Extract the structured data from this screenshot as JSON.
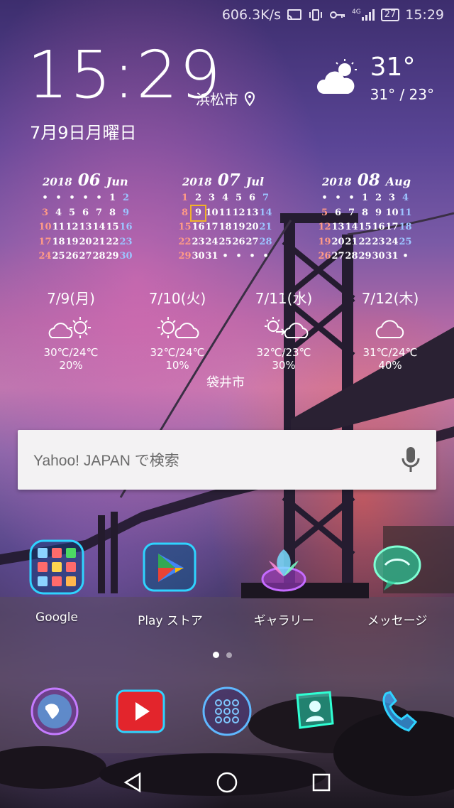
{
  "status_bar": {
    "speed": "606.3K/s",
    "network": "4G",
    "battery": "27",
    "time": "15:29"
  },
  "clock_widget": {
    "time": "15:29",
    "city": "浜松市",
    "date": "7月9日月曜日",
    "temp_now": "31°",
    "temp_range": "31° / 23°"
  },
  "calendars": [
    {
      "year": "2018",
      "month_num": "06",
      "month_name": "Jun",
      "cells": [
        "•",
        "•",
        "•",
        "•",
        "•",
        "1",
        "2",
        "3",
        "4",
        "5",
        "6",
        "7",
        "8",
        "9",
        "10",
        "11",
        "12",
        "13",
        "14",
        "15",
        "16",
        "17",
        "18",
        "19",
        "20",
        "21",
        "22",
        "23",
        "24",
        "25",
        "26",
        "27",
        "28",
        "29",
        "30"
      ]
    },
    {
      "year": "2018",
      "month_num": "07",
      "month_name": "Jul",
      "cells": [
        "1",
        "2",
        "3",
        "4",
        "5",
        "6",
        "7",
        "8",
        "9",
        "10",
        "11",
        "12",
        "13",
        "14",
        "15",
        "16",
        "17",
        "18",
        "19",
        "20",
        "21",
        "22",
        "23",
        "24",
        "25",
        "26",
        "27",
        "28",
        "29",
        "30",
        "31",
        "•",
        "•",
        "•",
        "•"
      ]
    },
    {
      "year": "2018",
      "month_num": "08",
      "month_name": "Aug",
      "cells": [
        "•",
        "•",
        "•",
        "1",
        "2",
        "3",
        "4",
        "5",
        "6",
        "7",
        "8",
        "9",
        "10",
        "11",
        "12",
        "13",
        "14",
        "15",
        "16",
        "17",
        "18",
        "19",
        "20",
        "21",
        "22",
        "23",
        "24",
        "25",
        "26",
        "27",
        "28",
        "29",
        "30",
        "31",
        "•"
      ]
    }
  ],
  "forecast": [
    {
      "date": "7/9(月)",
      "icon": "cloud-sun-icon",
      "temp": "30℃/24℃",
      "rain": "20%"
    },
    {
      "date": "7/10(火)",
      "icon": "sun-cloud-icon",
      "temp": "32℃/24℃",
      "rain": "10%"
    },
    {
      "date": "7/11(水)",
      "icon": "sun-to-cloud-icon",
      "temp": "32℃/23℃",
      "rain": "30%"
    },
    {
      "date": "7/12(木)",
      "icon": "cloud-icon",
      "temp": "31℃/24℃",
      "rain": "40%"
    }
  ],
  "forecast_location": "袋井市",
  "search": {
    "placeholder": "Yahoo! JAPAN で検索",
    "icon": "mic-icon"
  },
  "apps": [
    {
      "label": "Google",
      "icon": "google-folder-icon"
    },
    {
      "label": "Play ストア",
      "icon": "play-store-icon"
    },
    {
      "label": "ギャラリー",
      "icon": "gallery-icon"
    },
    {
      "label": "メッセージ",
      "icon": "messages-icon"
    }
  ],
  "dock": [
    {
      "icon": "browser-icon"
    },
    {
      "icon": "youtube-icon"
    },
    {
      "icon": "app-drawer-icon"
    },
    {
      "icon": "contacts-icon"
    },
    {
      "icon": "phone-icon"
    }
  ],
  "colors": {
    "accent_neon": "#2fd3ff",
    "today_box": "#f2b227",
    "sunday": "#ff9a86",
    "saturday": "#9cc4ff"
  }
}
